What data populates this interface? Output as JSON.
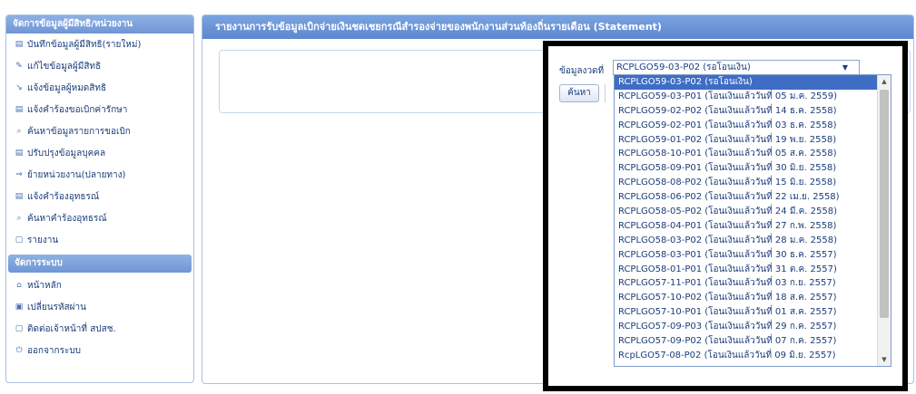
{
  "sidebar": {
    "section1_title": "จัดการข้อมูลผู้มีสิทธิ/หน่วยงาน",
    "section1_items": [
      {
        "icon": "save-icon",
        "glyph": "▤",
        "label": "บันทึกข้อมูลผู้มีสิทธิ(รายใหม่)"
      },
      {
        "icon": "edit-icon",
        "glyph": "✎",
        "label": "แก้ไขข้อมูลผู้มีสิทธิ"
      },
      {
        "icon": "notify-icon",
        "glyph": "↘",
        "label": "แจ้งข้อมูลผู้หมดสิทธิ"
      },
      {
        "icon": "form-icon",
        "glyph": "▤",
        "label": "แจ้งคำร้องขอเบิกค่ารักษา"
      },
      {
        "icon": "search-icon",
        "glyph": "⌕",
        "label": "ค้นหาข้อมูลรายการขอเบิก"
      },
      {
        "icon": "form-icon",
        "glyph": "▤",
        "label": "ปรับปรุงข้อมูลบุคคล"
      },
      {
        "icon": "move-icon",
        "glyph": "⇒",
        "label": "ย้ายหน่วยงาน(ปลายทาง)"
      },
      {
        "icon": "form-icon",
        "glyph": "▤",
        "label": "แจ้งคำร้องอุทธรณ์"
      },
      {
        "icon": "search-icon",
        "glyph": "⌕",
        "label": "ค้นหาคำร้องอุทธรณ์"
      },
      {
        "icon": "report-icon",
        "glyph": "▢",
        "label": "รายงาน"
      }
    ],
    "section2_title": "จัดการระบบ",
    "section2_items": [
      {
        "icon": "home-icon",
        "glyph": "⌂",
        "label": "หน้าหลัก"
      },
      {
        "icon": "lock-icon",
        "glyph": "▣",
        "label": "เปลี่ยนรหัสผ่าน"
      },
      {
        "icon": "contact-icon",
        "glyph": "▢",
        "label": "ติดต่อเจ้าหน้าที่ สปสช."
      },
      {
        "icon": "logout-icon",
        "glyph": "⏻",
        "label": "ออกจากระบบ"
      }
    ]
  },
  "main": {
    "title": "รายงานการรับข้อมูลเบิกจ่ายเงินชดเชยกรณีสำรองจ่ายของพนักงานส่วนท้องถิ่นรายเดือน (Statement)",
    "period_label": "ข้อมูลงวดที่",
    "selected_value": "RCPLGO59-03-P02 (รอโอนเงิน)",
    "search_label": "ค้นหา",
    "options": [
      "RCPLGO59-03-P02 (รอโอนเงิน)",
      "RCPLGO59-03-P01 (โอนเงินแล้ววันที่ 05 ม.ค. 2559)",
      "RCPLGO59-02-P02 (โอนเงินแล้ววันที่ 14 ธ.ค. 2558)",
      "RCPLGO59-02-P01 (โอนเงินแล้ววันที่ 03 ธ.ค. 2558)",
      "RCPLGO59-01-P02 (โอนเงินแล้ววันที่ 19 พ.ย. 2558)",
      "RCPLGO58-10-P01 (โอนเงินแล้ววันที่ 05 ส.ค. 2558)",
      "RCPLGO58-09-P01 (โอนเงินแล้ววันที่ 30 มิ.ย. 2558)",
      "RCPLGO58-08-P02 (โอนเงินแล้ววันที่ 15 มิ.ย. 2558)",
      "RCPLGO58-06-P02 (โอนเงินแล้ววันที่ 22 เม.ย. 2558)",
      "RCPLGO58-05-P02 (โอนเงินแล้ววันที่ 24 มี.ค. 2558)",
      "RCPLGO58-04-P01 (โอนเงินแล้ววันที่ 27 ก.พ. 2558)",
      "RCPLGO58-03-P02 (โอนเงินแล้ววันที่ 28 ม.ค. 2558)",
      "RCPLGO58-03-P01 (โอนเงินแล้ววันที่ 30 ธ.ค. 2557)",
      "RCPLGO58-01-P01 (โอนเงินแล้ววันที่ 31 ต.ค. 2557)",
      "RCPLGO57-11-P01 (โอนเงินแล้ววันที่ 03 ก.ย. 2557)",
      "RCPLGO57-10-P02 (โอนเงินแล้ววันที่ 18 ส.ค. 2557)",
      "RCPLGO57-10-P01 (โอนเงินแล้ววันที่ 01 ส.ค. 2557)",
      "RCPLGO57-09-P03 (โอนเงินแล้ววันที่ 29 ก.ค. 2557)",
      "RCPLGO57-09-P02 (โอนเงินแล้ววันที่ 07 ก.ค. 2557)",
      "RcpLGO57-08-P02 (โอนเงินแล้ววันที่ 09 มิ.ย. 2557)"
    ]
  },
  "colors": {
    "header_blue": "#6f96d6",
    "selected_option": "#3f6dc4",
    "text_blue": "#1a3d7a",
    "highlight_frame": "#000000"
  }
}
